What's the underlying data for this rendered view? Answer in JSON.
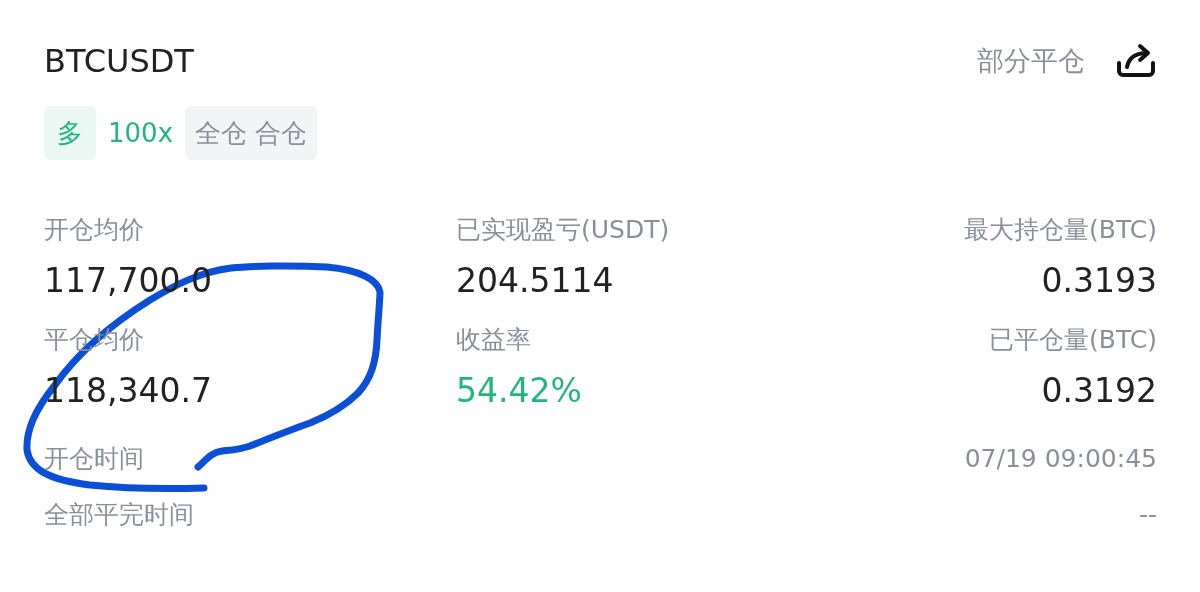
{
  "header": {
    "symbol": "BTCUSDT",
    "action": "部分平仓"
  },
  "tags": [
    {
      "text": "多",
      "kind": "side"
    },
    {
      "text": "100x",
      "kind": "leverage"
    },
    {
      "text": "全仓 合仓",
      "kind": "mode"
    }
  ],
  "stats": [
    {
      "label": "开仓均价",
      "value": "117,700.0",
      "positive": false
    },
    {
      "label": "已实现盈亏(USDT)",
      "value": "204.5114",
      "positive": false
    },
    {
      "label": "最大持仓量(BTC)",
      "value": "0.3193",
      "positive": false
    },
    {
      "label": "平仓均价",
      "value": "118,340.7",
      "positive": false
    },
    {
      "label": "收益率",
      "value": "54.42%",
      "positive": true
    },
    {
      "label": "已平仓量(BTC)",
      "value": "0.3192",
      "positive": false
    }
  ],
  "times": [
    {
      "label": "开仓时间",
      "value": "07/19 09:00:45"
    },
    {
      "label": "全部平完时间",
      "value": "--"
    }
  ]
}
